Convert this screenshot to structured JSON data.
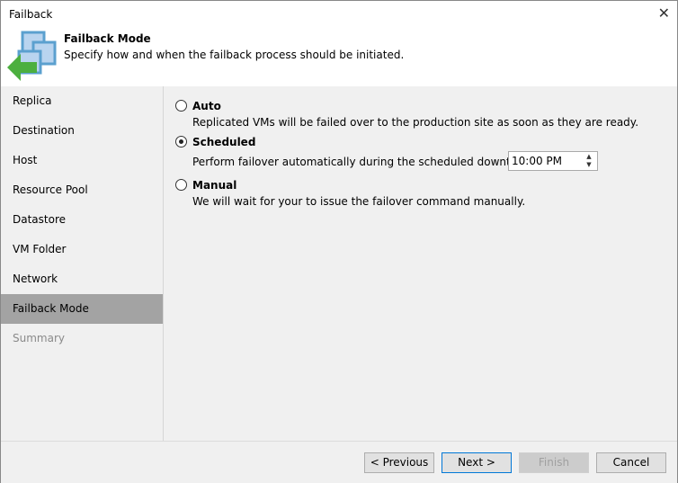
{
  "window": {
    "title": "Failback"
  },
  "header": {
    "title": "Failback Mode",
    "subtitle": "Specify how and when the failback process should be initiated."
  },
  "sidebar": {
    "items": [
      {
        "label": "Replica"
      },
      {
        "label": "Destination"
      },
      {
        "label": "Host"
      },
      {
        "label": "Resource Pool"
      },
      {
        "label": "Datastore"
      },
      {
        "label": "VM Folder"
      },
      {
        "label": "Network"
      },
      {
        "label": "Failback Mode"
      },
      {
        "label": "Summary"
      }
    ]
  },
  "options": [
    {
      "label": "Auto",
      "desc": "Replicated VMs will be failed over to the production site as soon as they are ready."
    },
    {
      "label": "Scheduled",
      "desc": "Perform failover automatically during the scheduled downtime at:"
    },
    {
      "label": "Manual",
      "desc": "We will wait for your to issue the failover command manually."
    }
  ],
  "time_value": "10:00 PM",
  "buttons": {
    "previous": "< Previous",
    "next": "Next >",
    "finish": "Finish",
    "cancel": "Cancel"
  }
}
